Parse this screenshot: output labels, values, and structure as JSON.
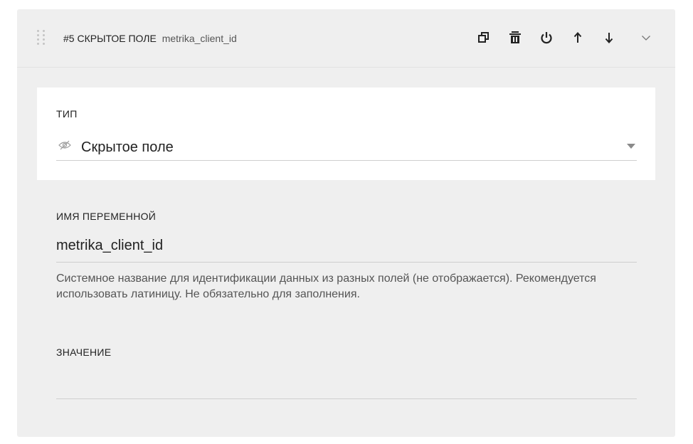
{
  "header": {
    "title": "#5 СКРЫТОЕ ПОЛЕ",
    "variable": "metrika_client_id",
    "actions": [
      "copy-icon",
      "delete-icon",
      "power-icon",
      "arrow-up-icon",
      "arrow-down-icon",
      "chevron-down-icon"
    ]
  },
  "type_field": {
    "label": "ТИП",
    "value": "Скрытое поле",
    "icon": "eye-off-icon"
  },
  "name_field": {
    "label": "ИМЯ ПЕРЕМЕННОЙ",
    "value": "metrika_client_id",
    "hint": "Системное название для идентификации данных из разных полей (не отображается). Рекомендуется использовать латиницу. Не обязательно для заполнения."
  },
  "value_field": {
    "label": "ЗНАЧЕНИЕ",
    "value": ""
  }
}
